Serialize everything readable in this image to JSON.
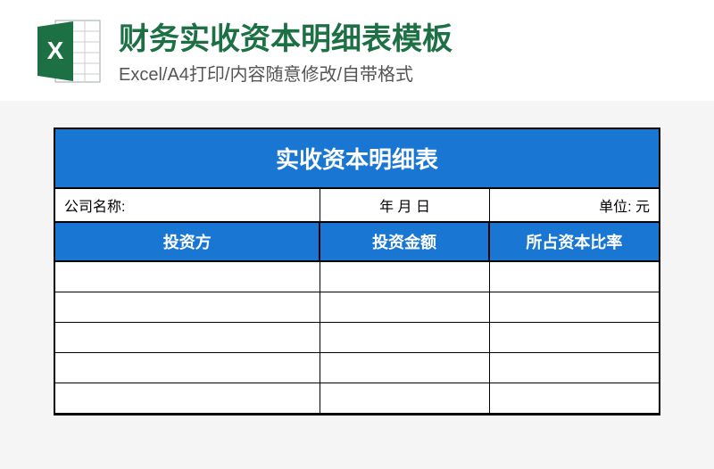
{
  "header": {
    "title": "财务实收资本明细表模板",
    "subtitle": "Excel/A4打印/内容随意修改/自带格式",
    "icon_label": "X"
  },
  "sheet": {
    "title": "实收资本明细表",
    "meta": {
      "company_label": "公司名称:",
      "date_label": "年   月   日",
      "unit_label": "单位: 元"
    },
    "columns": {
      "investor": "投资方",
      "amount": "投资金额",
      "ratio": "所占资本比率"
    }
  }
}
